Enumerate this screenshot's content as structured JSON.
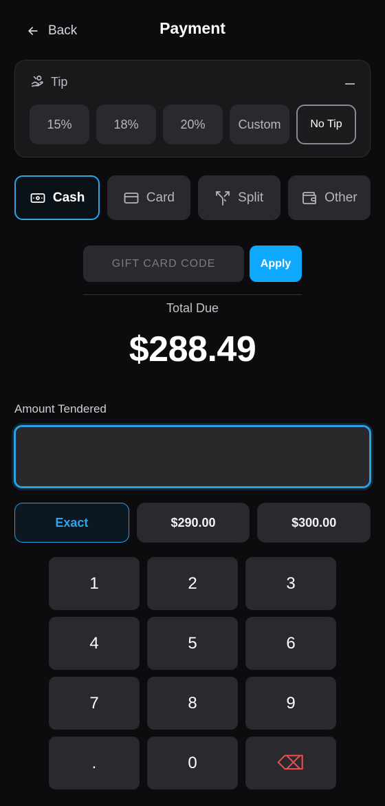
{
  "header": {
    "back_label": "Back",
    "title": "Payment"
  },
  "tip": {
    "label": "Tip",
    "options": [
      "15%",
      "18%",
      "20%",
      "Custom",
      "No Tip"
    ],
    "selected": "No Tip"
  },
  "payment_methods": [
    {
      "label": "Cash",
      "icon": "cash-icon",
      "active": true
    },
    {
      "label": "Card",
      "icon": "card-icon",
      "active": false
    },
    {
      "label": "Split",
      "icon": "split-icon",
      "active": false
    },
    {
      "label": "Other",
      "icon": "wallet-icon",
      "active": false
    }
  ],
  "gift_card": {
    "placeholder": "GIFT CARD CODE",
    "apply_label": "Apply"
  },
  "total": {
    "label": "Total Due",
    "value": "$288.49"
  },
  "amount_tendered": {
    "label": "Amount Tendered",
    "value": ""
  },
  "quick_amounts": [
    "Exact",
    "$290.00",
    "$300.00"
  ],
  "keypad": [
    "1",
    "2",
    "3",
    "4",
    "5",
    "6",
    "7",
    "8",
    "9",
    ".",
    "0",
    "⌫"
  ],
  "colors": {
    "background": "#0c0c0e",
    "surface": "#2a2a2e",
    "accent": "#0ea8ff",
    "accent_border": "#2a9fe6",
    "danger": "#ef4b4b"
  }
}
